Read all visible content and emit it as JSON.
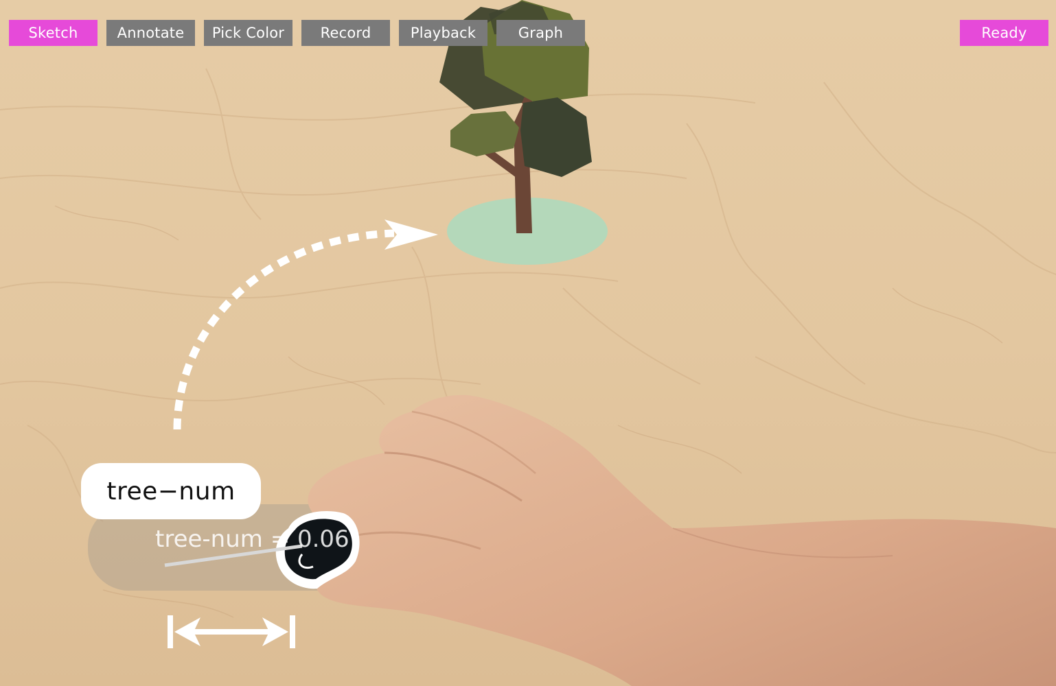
{
  "toolbar": {
    "buttons": [
      {
        "id": "sketch",
        "label": "Sketch"
      },
      {
        "id": "annotate",
        "label": "Annotate"
      },
      {
        "id": "pick_color",
        "label": "Pick Color"
      },
      {
        "id": "record",
        "label": "Record"
      },
      {
        "id": "playback",
        "label": "Playback"
      },
      {
        "id": "graph",
        "label": "Graph"
      }
    ],
    "status_label": "Ready"
  },
  "overlay": {
    "variable_label": "tree−num",
    "variable_readout": "tree-num = 0.06"
  },
  "colors": {
    "accent_pink": "#e64ad9",
    "button_gray": "#7a7a7a",
    "ground_disc": "#a8dcc0"
  },
  "icons": [
    "curved-dotted-arrow-icon",
    "horizontal-double-arrow-icon",
    "tree-model-icon",
    "marker-token-icon"
  ]
}
